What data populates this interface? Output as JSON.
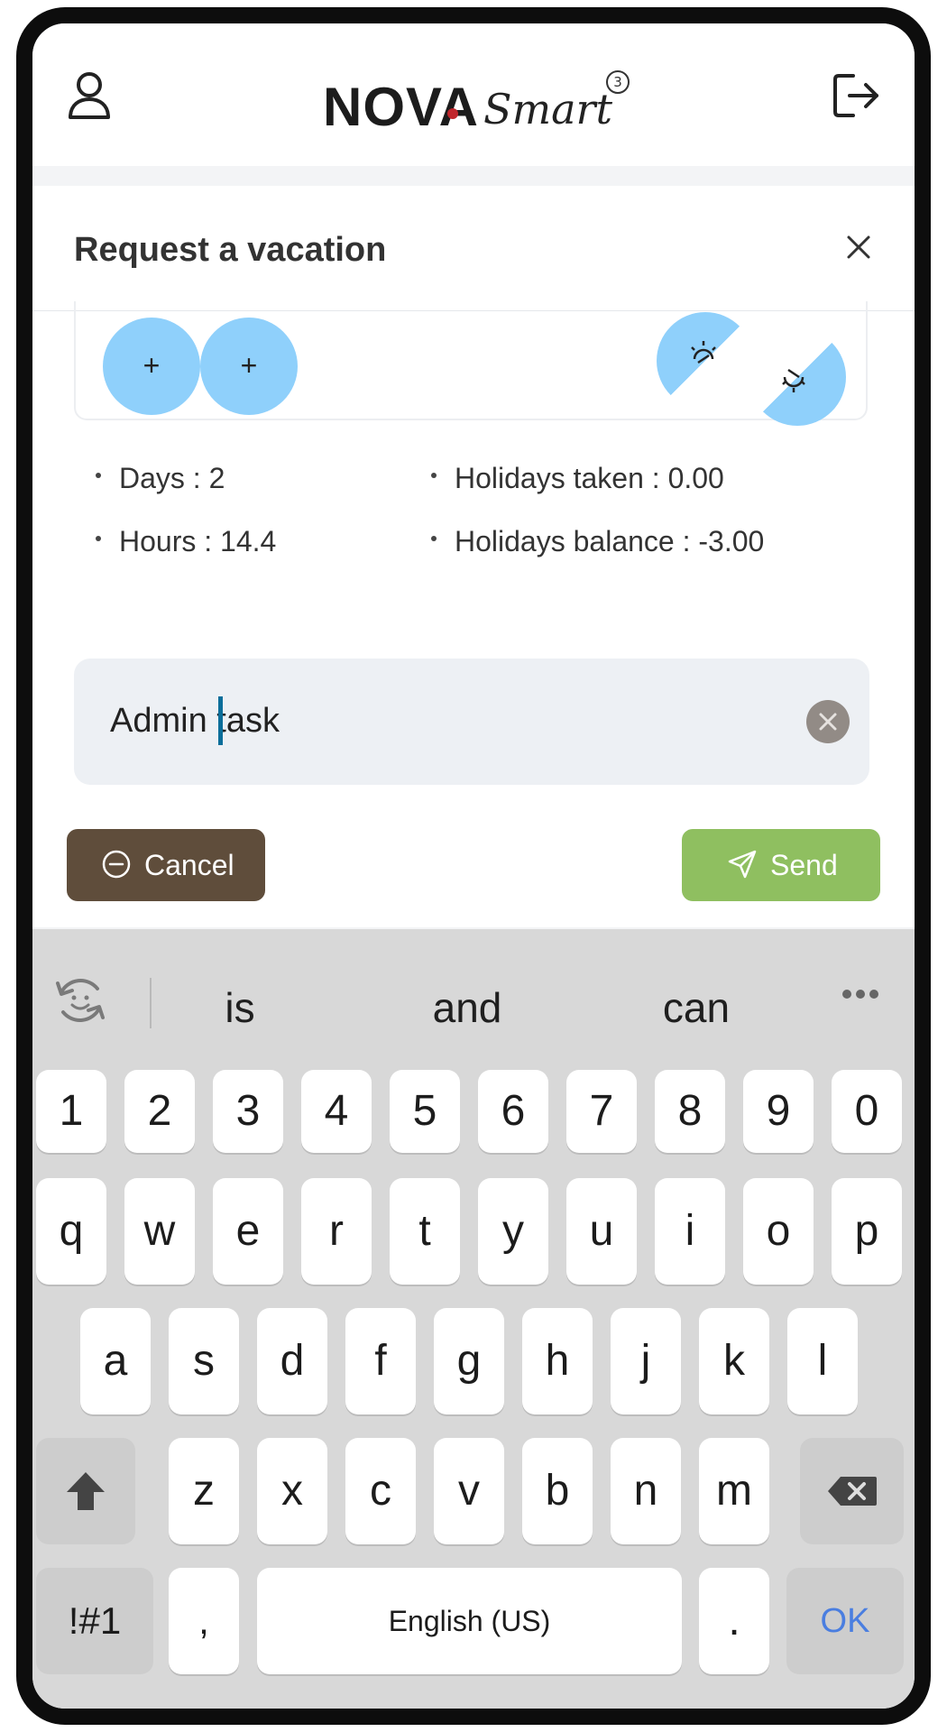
{
  "header": {
    "logo_main": "NOVA",
    "logo_sub": "Smart",
    "logo_badge": "3",
    "icons": {
      "user": "user-icon",
      "logout": "logout-icon"
    }
  },
  "modal": {
    "title": "Request a vacation",
    "stats": {
      "days": "Days : 2",
      "hours": "Hours : 14.4",
      "holidays_taken": "Holidays taken : 0.00",
      "holidays_balance": "Holidays balance : -3.00"
    },
    "add_label": "+",
    "reason": {
      "value": "Admin task"
    },
    "buttons": {
      "cancel": "Cancel",
      "send": "Send"
    },
    "colors": {
      "accent_circle": "#8fd0fb",
      "cancel": "#5f4d3b",
      "send": "#8fbf60"
    }
  },
  "keyboard": {
    "suggestions": [
      "is",
      "and",
      "can"
    ],
    "number_row": [
      "1",
      "2",
      "3",
      "4",
      "5",
      "6",
      "7",
      "8",
      "9",
      "0"
    ],
    "row1": [
      "q",
      "w",
      "e",
      "r",
      "t",
      "y",
      "u",
      "i",
      "o",
      "p"
    ],
    "row2": [
      "a",
      "s",
      "d",
      "f",
      "g",
      "h",
      "j",
      "k",
      "l"
    ],
    "row3": [
      "z",
      "x",
      "c",
      "v",
      "b",
      "n",
      "m"
    ],
    "symbols_key": "!#1",
    "comma_key": ",",
    "space_key": "English (US)",
    "period_key": ".",
    "ok_key": "OK",
    "ok_color": "#4a7ee0"
  }
}
